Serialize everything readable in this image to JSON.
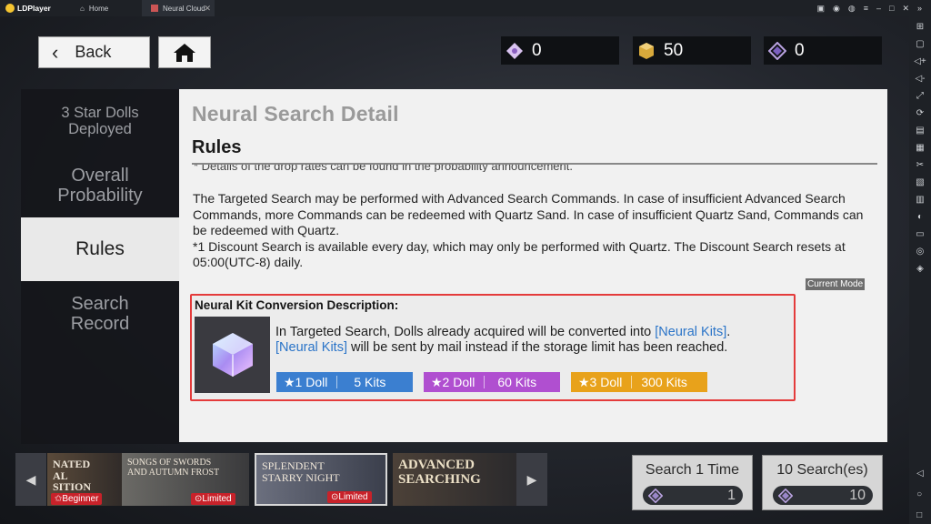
{
  "window": {
    "app_name": "LDPlayer",
    "tabs": [
      {
        "label": "Home"
      },
      {
        "label": "Neural Cloud"
      }
    ]
  },
  "top": {
    "back_label": "Back",
    "resources": [
      {
        "icon": "diamond-icon",
        "value": "0"
      },
      {
        "icon": "quartz-cube-icon",
        "value": "50"
      },
      {
        "icon": "search-command-icon",
        "value": "0"
      }
    ]
  },
  "nav": {
    "items": [
      {
        "label": "3 Star Dolls Deployed"
      },
      {
        "label": "Overall Probability"
      },
      {
        "label": "Rules"
      },
      {
        "label": "Search Record"
      }
    ]
  },
  "panel": {
    "title": "Neural Search Detail",
    "section": "Rules",
    "cut_off_line": "* Details of the drop rates can be found in the probability announcement.",
    "para1": "The Targeted Search may be performed with Advanced Search Commands. In case of insufficient Advanced Search Commands, more Commands can be redeemed with Quartz Sand. In case of insufficient Quartz Sand, Commands can be redeemed with Quartz.",
    "para2": "*1 Discount Search is available every day, which may only be performed with Quartz. The Discount Search resets at 05:00(UTC-8) daily.",
    "current_mode": "Current Mode",
    "kit": {
      "heading": "Neural Kit Conversion Description:",
      "text_a": "In Targeted Search, Dolls already acquired will be converted into ",
      "link1": "[Neural Kits]",
      "text_b": ".",
      "link2": "[Neural Kits]",
      "text_c": " will be sent by mail instead if the storage limit has been reached.",
      "pills": [
        {
          "doll": "★1 Doll",
          "kits": "5 Kits",
          "color": "#3b7fd0"
        },
        {
          "doll": "★2 Doll",
          "kits": "60 Kits",
          "color": "#b04fd0"
        },
        {
          "doll": "★3 Doll",
          "kits": "300 Kits",
          "color": "#e8a21b"
        }
      ]
    }
  },
  "banners": [
    {
      "title": "NATED\nAL\nSITION",
      "tag": "✩Beginner"
    },
    {
      "title": "SONGS OF SWORDS\nAND AUTUMN FROST",
      "tag": "⊙Limited"
    },
    {
      "title": "SPLENDENT\nSTARRY NIGHT",
      "tag": "⊙Limited"
    },
    {
      "title": "ADVANCED\nSEARCHING",
      "tag": ""
    }
  ],
  "search": {
    "one": {
      "label": "Search 1 Time",
      "cost": "1"
    },
    "ten": {
      "label": "10 Search(es)",
      "cost": "10"
    }
  }
}
